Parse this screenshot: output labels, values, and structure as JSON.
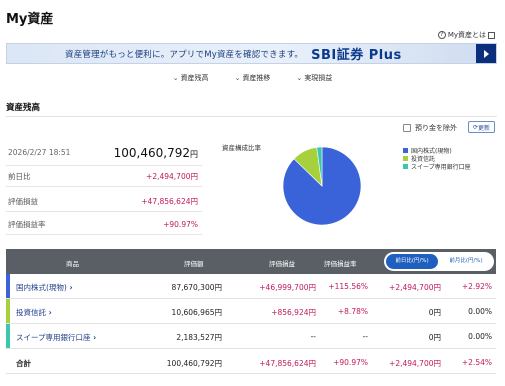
{
  "title": "My資産",
  "about_link": "My資産とは",
  "banner": {
    "text": "資産管理がもっと便利に。アプリでMy資産を確認できます。",
    "brand": "SBI証券 Plus"
  },
  "anchors": [
    "資産残高",
    "資産推移",
    "実現損益"
  ],
  "section_title": "資産残高",
  "summary": {
    "datetime": "2026/2/27 18:51",
    "total": "100,460,792",
    "total_unit": "円",
    "rows": [
      {
        "label": "前日比",
        "value": "+2,494,700円"
      },
      {
        "label": "評価損益",
        "value": "+47,856,624円"
      },
      {
        "label": "評価損益率",
        "value": "+90.97%"
      }
    ]
  },
  "pie": {
    "title": "資産構成比率",
    "exclude_label": "預り金を除外",
    "refresh_label": "更新",
    "legend": [
      {
        "label": "国内株式(現物)",
        "color": "#3b63d9"
      },
      {
        "label": "投資信託",
        "color": "#a6d13d"
      },
      {
        "label": "スイープ専用銀行口座",
        "color": "#3cc6b0"
      }
    ]
  },
  "chart_data": {
    "type": "pie",
    "title": "資産構成比率",
    "slices": [
      {
        "label": "国内株式(現物)",
        "value": 87670300,
        "color": "#3b63d9"
      },
      {
        "label": "投資信託",
        "value": 10606965,
        "color": "#a6d13d"
      },
      {
        "label": "スイープ専用銀行口座",
        "value": 2183527,
        "color": "#3cc6b0"
      }
    ]
  },
  "table": {
    "headers": [
      "商品",
      "評価額",
      "評価損益",
      "評価損益率"
    ],
    "toggle_on": "前日比(円/%)",
    "toggle_off": "前月比(円/%)",
    "rows": [
      {
        "name": "国内株式(現物)",
        "color": "#3b63d9",
        "value": "87,670,300円",
        "pl": "+46,999,700円",
        "plr": "+115.56%",
        "diff": "+2,494,700円",
        "diffr": "+2.92%"
      },
      {
        "name": "投資信託",
        "color": "#a6d13d",
        "value": "10,606,965円",
        "pl": "+856,924円",
        "plr": "+8.78%",
        "diff": "0円",
        "diffr": "0.00%"
      },
      {
        "name": "スイープ専用銀行口座",
        "color": "#3cc6b0",
        "value": "2,183,527円",
        "pl": "--",
        "plr": "--",
        "diff": "0円",
        "diffr": "0.00%"
      }
    ],
    "total": {
      "label": "合計",
      "value": "100,460,792円",
      "pl": "+47,856,624円",
      "plr": "+90.97%",
      "diff": "+2,494,700円",
      "diffr": "+2.54%"
    }
  }
}
